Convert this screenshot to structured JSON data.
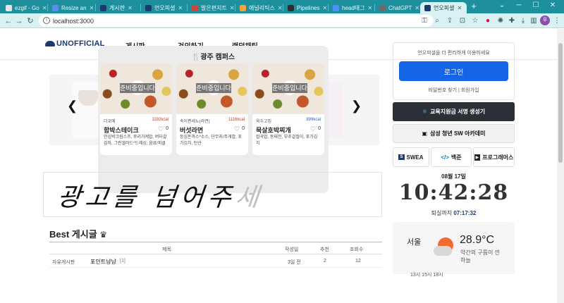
{
  "browser": {
    "tabs": [
      {
        "label": "ezgif - Go",
        "color": "#e5e5e5"
      },
      {
        "label": "Resize an",
        "color": "#5b8def"
      },
      {
        "label": "게시판",
        "color": "#1d3a6e"
      },
      {
        "label": "언오피셜",
        "color": "#1d3a6e"
      },
      {
        "label": "발은편지트",
        "color": "#c94a3a"
      },
      {
        "label": "애널리틱스",
        "color": "#f2a33a"
      },
      {
        "label": "Pipelines",
        "color": "#2f2f2f"
      },
      {
        "label": "head태그",
        "color": "#4f8ef7"
      },
      {
        "label": "ChatGPT",
        "color": "#6b6b6b"
      },
      {
        "label": "언오피셜",
        "color": "#1d3a6e"
      }
    ],
    "active_tab": 9,
    "url": "localhost:3000",
    "profile_initial": "우"
  },
  "site": {
    "logo": "UNOFFICIAL",
    "nav": [
      "게시판",
      "건의하기",
      "랜덤채팅"
    ]
  },
  "menu": {
    "title": "광주 캠퍼스",
    "badge": "준비중입니다",
    "cards": [
      {
        "category": "더교메",
        "kcal": "1192kcal",
        "name": "함박스테이크",
        "likes": "0",
        "desc": "안심박크림스프, 후리가케밥, 버터갈감자, 그린샐러드*드레싱, 음료/피클"
      },
      {
        "category": "속이편세뇨(라면)",
        "kcal": "1116kcal",
        "name": "버섯라면",
        "likes": "0",
        "desc": "등심돈까스*소스, 단무지/주개밥, 포기김치, 탄산"
      },
      {
        "category": "육수고집",
        "kcal": "899kcal",
        "name": "묵살호박찌개",
        "likes": "0",
        "desc": "잡곡밥, 동태전, 부추겉절이, 포기김치"
      }
    ]
  },
  "marquee": {
    "text": "광고를 넘어주",
    "fade": "세"
  },
  "best": {
    "title": "Best 게시글",
    "headers": [
      "제목",
      "작성일",
      "추천",
      "조회수"
    ],
    "rows": [
      {
        "board": "자유게시판",
        "title": "포인트냠냠",
        "comments": "[1]",
        "date": "3일 전",
        "likes": "2",
        "views": "12"
      }
    ]
  },
  "login": {
    "lead": "언오피셜을 더 편리하게 이용하세요",
    "button": "로그인",
    "links": "비밀번호 찾기 | 회원가입"
  },
  "buttons": {
    "sign": "교육지원금 서명 생성기",
    "ssafy": "삼성 청년 SW 아카데미",
    "swea": "SWEA",
    "baekjoon": "백준",
    "programmers": "프로그래머스"
  },
  "clock": {
    "date": "08월 17일",
    "time": "10:42:28",
    "remain_label": "퇴실까지",
    "remain_time": "07:17:32"
  },
  "weather": {
    "city": "서울",
    "temp": "28.9°C",
    "desc": "약간의 구름이 낀 하늘",
    "hours": "13시          15시          18시"
  }
}
